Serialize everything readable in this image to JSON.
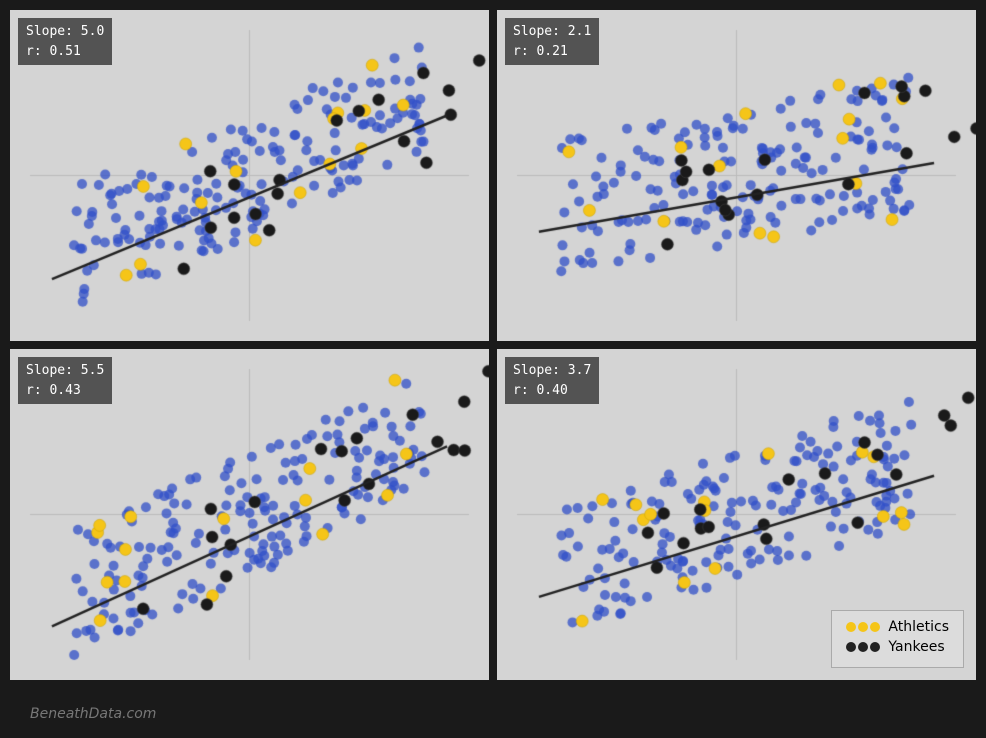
{
  "charts": [
    {
      "id": "chart-tl",
      "slope": "5.0",
      "r": "0.51",
      "position": "top-left"
    },
    {
      "id": "chart-tr",
      "slope": "2.1",
      "r": "0.21",
      "position": "top-right"
    },
    {
      "id": "chart-bl",
      "slope": "5.5",
      "r": "0.43",
      "position": "bottom-left"
    },
    {
      "id": "chart-br",
      "slope": "3.7",
      "r": "0.40",
      "position": "bottom-right",
      "has_legend": true
    }
  ],
  "legend": {
    "athletics_label": "Athletics",
    "yankees_label": "Yankees",
    "athletics_color": "#f5c518",
    "yankees_color": "#222222",
    "blue_color": "#3355cc"
  },
  "footer": {
    "text": "BeneathData.com"
  }
}
